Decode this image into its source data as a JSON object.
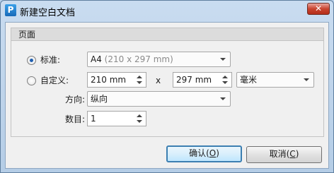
{
  "window": {
    "title": "新建空白文档",
    "app_icon_glyph": "P",
    "close_glyph": "✕"
  },
  "group": {
    "title": "页面"
  },
  "standard": {
    "label": "标准:",
    "selected": true,
    "value": "A4",
    "detail": "(210 x 297 mm)"
  },
  "custom": {
    "label": "自定义:",
    "selected": false,
    "width": "210 mm",
    "times": "x",
    "height": "297 mm",
    "unit": "毫米"
  },
  "orientation": {
    "label": "方向:",
    "value": "纵向"
  },
  "count": {
    "label": "数目:",
    "value": "1"
  },
  "buttons": {
    "ok": {
      "text": "确认(",
      "hotkey": "O",
      "close": ")"
    },
    "cancel": {
      "text": "取消(",
      "hotkey": "C",
      "close": ")"
    }
  }
}
